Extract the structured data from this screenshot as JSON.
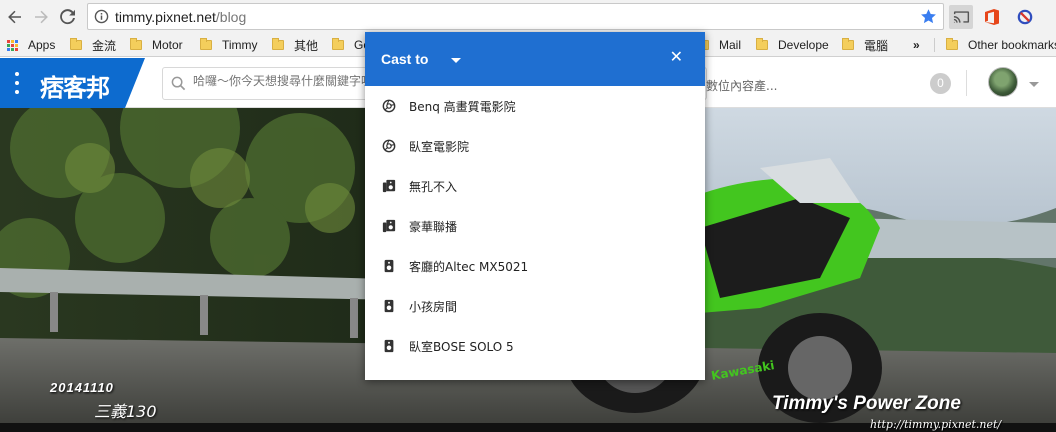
{
  "toolbar": {
    "url_host": "timmy.pixnet.net",
    "url_path": "/blog"
  },
  "bookmarks": [
    {
      "label": "Apps",
      "type": "apps"
    },
    {
      "label": "金流",
      "type": "folder"
    },
    {
      "label": "Motor",
      "type": "folder"
    },
    {
      "label": "Timmy",
      "type": "folder"
    },
    {
      "label": "其他",
      "type": "folder"
    },
    {
      "label": "Go",
      "type": "folder"
    },
    {
      "label": "Mail",
      "type": "folder"
    },
    {
      "label": "Develope",
      "type": "folder"
    },
    {
      "label": "電腦",
      "type": "folder"
    },
    {
      "label": "»",
      "type": "overflow"
    },
    {
      "label": "Other bookmarks",
      "type": "folder"
    }
  ],
  "site": {
    "logo": "痞客邦",
    "search_placeholder": "哈囉～你今天想搜尋什麼關鍵字呢？",
    "search_tail": "數位內容產...",
    "notification_count": "0"
  },
  "banner": {
    "date": "20141110",
    "location": "三義130",
    "title": "Timmy's Power Zone",
    "url": "http://timmy.pixnet.net/"
  },
  "cast": {
    "title": "Cast to",
    "devices": [
      {
        "label": "Benq 高畫質電影院",
        "icon": "chromecast-icon"
      },
      {
        "label": "臥室電影院",
        "icon": "chromecast-icon"
      },
      {
        "label": "無孔不入",
        "icon": "speaker-group-icon"
      },
      {
        "label": "豪華聯播",
        "icon": "speaker-group-icon"
      },
      {
        "label": "客廳的Altec MX5021",
        "icon": "speaker-icon"
      },
      {
        "label": "小孩房間",
        "icon": "speaker-icon"
      },
      {
        "label": "臥室BOSE SOLO 5",
        "icon": "speaker-icon"
      }
    ]
  },
  "colors": {
    "accent": "#1f6fd1",
    "logo_blue": "#0d6bcf"
  }
}
